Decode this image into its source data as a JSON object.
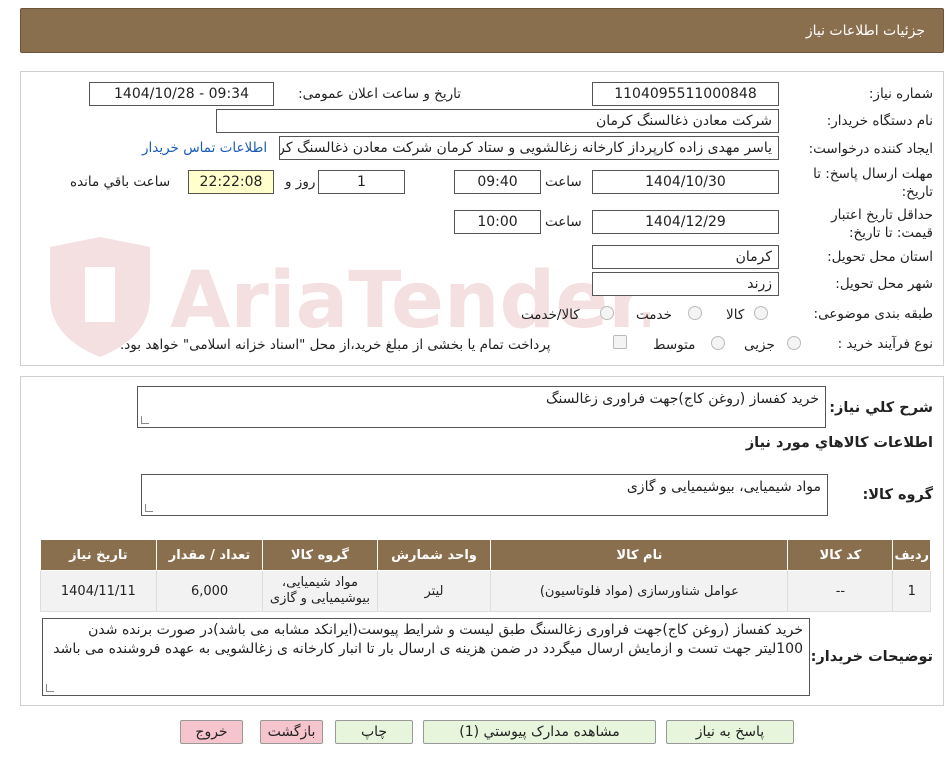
{
  "header": {
    "title": "جزئیات اطلاعات نیاز"
  },
  "watermark": {
    "text": "AriaTender.neT"
  },
  "form": {
    "need_number_label": "شماره نیاز:",
    "need_number": "1104095511000848",
    "announce_label": "تاریخ و ساعت اعلان عمومی:",
    "announce_value": "1404/10/28 - 09:34",
    "buyer_org_label": "نام دستگاه خریدار:",
    "buyer_org": "شرکت معادن ذغالسنگ کرمان",
    "requester_label": "ایجاد کننده درخواست:",
    "requester": "یاسر مهدی زاده کارپرداز کارخانه زغالشویی و ستاد کرمان شرکت معادن ذغالسنگ کرمان",
    "contact_link": "اطلاعات تماس خریدار",
    "deadline_label_1": "مهلت ارسال پاسخ: تا",
    "deadline_label_2": "تاریخ:",
    "deadline_date": "1404/10/30",
    "time_label": "ساعت",
    "deadline_time": "09:40",
    "days_value": "1",
    "days_label": "روز و",
    "remaining_time": "22:22:08",
    "remaining_label": "ساعت باقي مانده",
    "validity_label_1": "حداقل تاریخ اعتبار",
    "validity_label_2": "قیمت: تا تاریخ:",
    "validity_date": "1404/12/29",
    "validity_time": "10:00",
    "province_label": "استان محل تحویل:",
    "province": "کرمان",
    "city_label": "شهر محل تحویل:",
    "city": "زرند",
    "category_label": "طبقه بندی موضوعی:",
    "category_options": [
      "کالا",
      "خدمت",
      "کالا/خدمت"
    ],
    "process_label": "نوع فرآیند خرید :",
    "process_options": [
      "جزیی",
      "متوسط"
    ],
    "treasury_note": "پرداخت تمام یا بخشی از مبلغ خرید،از محل \"اسناد خزانه اسلامی\" خواهد بود."
  },
  "summary": {
    "label": "شرح کلي نياز:",
    "value": "خرید کفساز (روغن کاج)جهت فراوری زغالسنگ"
  },
  "goods": {
    "section_title": "اطلاعات کالاهاي مورد نياز",
    "group_label": "گروه کالا:",
    "group_value": "مواد شیمیایی، بیوشیمیایی و  گازی",
    "columns": [
      "رديف",
      "کد کالا",
      "نام کالا",
      "واحد شمارش",
      "گروه کالا",
      "تعداد / مقدار",
      "تاریخ نیاز"
    ],
    "rows": [
      {
        "index": "1",
        "code": "--",
        "name": "عوامل شناورسازی (مواد فلوتاسیون)",
        "unit": "لیتر",
        "group_line1": "مواد شیمیایی،",
        "group_line2": "بیوشیمیایی و گازی",
        "quantity": "6,000",
        "date": "1404/11/11"
      }
    ]
  },
  "buyer_notes": {
    "label": "توضیحات خریدار:",
    "value": "خرید کفساز (روغن کاج)جهت فراوری زغالسنگ طبق لیست و شرایط پیوست(ایرانکد مشابه می باشد)در صورت برنده شدن 100لیتر جهت تست و ازمایش ارسال میگردد در ضمن هزینه ی ارسال بار تا انبار کارخانه ی زغالشویی به عهده فروشنده می باشد"
  },
  "buttons": {
    "reply": "پاسخ به نیاز",
    "attachments": "مشاهده مدارک پیوستي (1)",
    "print": "چاپ",
    "back": "بازگشت",
    "exit": "خروج"
  },
  "colors": {
    "header_bg": "#8a6f4e",
    "button_green": "#e6f5dc",
    "button_pink": "#f6c4cd",
    "link": "#1a5bb8",
    "highlight": "#ffffcc"
  }
}
